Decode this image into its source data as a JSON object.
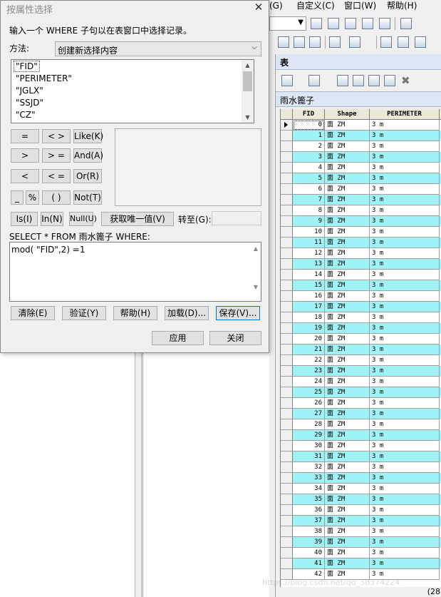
{
  "app": {
    "menu": [
      "(G)",
      "自定义(C)",
      "窗口(W)",
      "帮助(H)"
    ]
  },
  "table_window": {
    "title": "表",
    "tab": "雨水篦子",
    "columns": [
      "FID",
      "Shape",
      "PERIMETER"
    ],
    "rows": [
      {
        "fid": "0",
        "shape": "面 ZM",
        "perimeter": "3 m"
      },
      {
        "fid": "1",
        "shape": "面 ZM",
        "perimeter": "3 m"
      },
      {
        "fid": "2",
        "shape": "面 ZM",
        "perimeter": "3 m"
      },
      {
        "fid": "3",
        "shape": "面 ZM",
        "perimeter": "3 m"
      },
      {
        "fid": "4",
        "shape": "面 ZM",
        "perimeter": "3 m"
      },
      {
        "fid": "5",
        "shape": "面 ZM",
        "perimeter": "3 m"
      },
      {
        "fid": "6",
        "shape": "面 ZM",
        "perimeter": "3 m"
      },
      {
        "fid": "7",
        "shape": "面 ZM",
        "perimeter": "3 m"
      },
      {
        "fid": "8",
        "shape": "面 ZM",
        "perimeter": "3 m"
      },
      {
        "fid": "9",
        "shape": "面 ZM",
        "perimeter": "3 m"
      },
      {
        "fid": "10",
        "shape": "面 ZM",
        "perimeter": "3 m"
      },
      {
        "fid": "11",
        "shape": "面 ZM",
        "perimeter": "3 m"
      },
      {
        "fid": "12",
        "shape": "面 ZM",
        "perimeter": "3 m"
      },
      {
        "fid": "13",
        "shape": "面 ZM",
        "perimeter": "3 m"
      },
      {
        "fid": "14",
        "shape": "面 ZM",
        "perimeter": "3 m"
      },
      {
        "fid": "15",
        "shape": "面 ZM",
        "perimeter": "3 m"
      },
      {
        "fid": "16",
        "shape": "面 ZM",
        "perimeter": "3 m"
      },
      {
        "fid": "17",
        "shape": "面 ZM",
        "perimeter": "3 m"
      },
      {
        "fid": "18",
        "shape": "面 ZM",
        "perimeter": "3 m"
      },
      {
        "fid": "19",
        "shape": "面 ZM",
        "perimeter": "3 m"
      },
      {
        "fid": "20",
        "shape": "面 ZM",
        "perimeter": "3 m"
      },
      {
        "fid": "21",
        "shape": "面 ZM",
        "perimeter": "3 m"
      },
      {
        "fid": "22",
        "shape": "面 ZM",
        "perimeter": "3 m"
      },
      {
        "fid": "23",
        "shape": "面 ZM",
        "perimeter": "3 m"
      },
      {
        "fid": "24",
        "shape": "面 ZM",
        "perimeter": "3 m"
      },
      {
        "fid": "25",
        "shape": "面 ZM",
        "perimeter": "3 m"
      },
      {
        "fid": "26",
        "shape": "面 ZM",
        "perimeter": "3 m"
      },
      {
        "fid": "27",
        "shape": "面 ZM",
        "perimeter": "3 m"
      },
      {
        "fid": "28",
        "shape": "面 ZM",
        "perimeter": "3 m"
      },
      {
        "fid": "29",
        "shape": "面 ZM",
        "perimeter": "3 m"
      },
      {
        "fid": "30",
        "shape": "面 ZM",
        "perimeter": "3 m"
      },
      {
        "fid": "31",
        "shape": "面 ZM",
        "perimeter": "3 m"
      },
      {
        "fid": "32",
        "shape": "面 ZM",
        "perimeter": "3 m"
      },
      {
        "fid": "33",
        "shape": "面 ZM",
        "perimeter": "3 m"
      },
      {
        "fid": "34",
        "shape": "面 ZM",
        "perimeter": "3 m"
      },
      {
        "fid": "35",
        "shape": "面 ZM",
        "perimeter": "3 m"
      },
      {
        "fid": "36",
        "shape": "面 ZM",
        "perimeter": "3 m"
      },
      {
        "fid": "37",
        "shape": "面 ZM",
        "perimeter": "3 m"
      },
      {
        "fid": "38",
        "shape": "面 ZM",
        "perimeter": "3 m"
      },
      {
        "fid": "39",
        "shape": "面 ZM",
        "perimeter": "3 m"
      },
      {
        "fid": "40",
        "shape": "面 ZM",
        "perimeter": "3 m"
      },
      {
        "fid": "41",
        "shape": "面 ZM",
        "perimeter": "3 m"
      },
      {
        "fid": "42",
        "shape": "面 ZM",
        "perimeter": "3 m"
      }
    ],
    "selected_fill": "#9ff3f6",
    "status_fragment": "(28"
  },
  "dialog": {
    "title": "按属性选择",
    "instruction": "输入一个 WHERE 子句以在表窗口中选择记录。",
    "method_label": "方法:",
    "method_value": "创建新选择内容",
    "fields": [
      "\"FID\"",
      "\"PERIMETER\"",
      "\"JGLX\"",
      "\"SSJD\"",
      "\"CZ\""
    ],
    "operators": {
      "eq": "=",
      "ne": "< >",
      "like": "Like(K)",
      "gt": ">",
      "ge": "> =",
      "and": "And(A)",
      "lt": "<",
      "le": "< =",
      "or": "Or(R)",
      "underscore": "_",
      "percent": "%",
      "parens": "( )",
      "not": "Not(T)",
      "is": "Is(I)",
      "in": "In(N)",
      "null": "Null(U)"
    },
    "unique_values_button": "获取唯一值(V)",
    "goto_label": "转至(G):",
    "sql_prefix": "SELECT * FROM 雨水篦子 WHERE:",
    "where_clause": "mod( \"FID\",2) =1",
    "buttons": {
      "clear": "清除(E)",
      "verify": "验证(Y)",
      "help": "帮助(H)",
      "load": "加载(D)...",
      "save": "保存(V)...",
      "apply": "应用",
      "close": "关闭"
    }
  },
  "watermark": "https://blog.csdn.net/qq_38374224"
}
